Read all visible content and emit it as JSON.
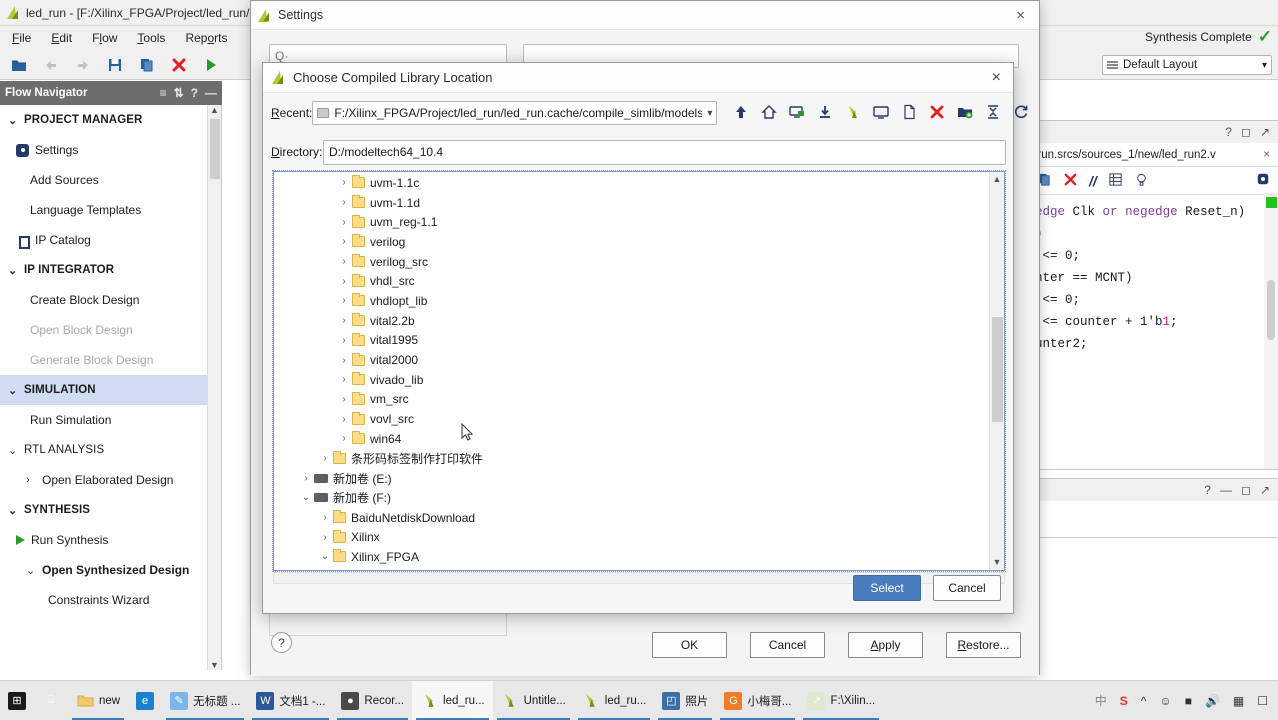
{
  "vivado": {
    "title": "led_run - [F:/Xilinx_FPGA/Project/led_run/le",
    "menus": [
      "File",
      "Edit",
      "Flow",
      "Tools",
      "Reports"
    ],
    "status_label": "Synthesis Complete",
    "layout_value": "Default Layout",
    "flow_navigator": {
      "title": "Flow Navigator",
      "items": [
        {
          "label": "PROJECT MANAGER",
          "type": "section",
          "chevron": "⌄",
          "highlight": false
        },
        {
          "label": "Settings",
          "type": "item-icon",
          "icon": "gear-icon"
        },
        {
          "label": "Add Sources",
          "type": "item"
        },
        {
          "label": "Language Templates",
          "type": "item"
        },
        {
          "label": "IP Catalog",
          "type": "item-icon",
          "icon": "ip-catalog-icon"
        },
        {
          "label": "IP INTEGRATOR",
          "type": "section",
          "chevron": "⌄",
          "highlight": false
        },
        {
          "label": "Create Block Design",
          "type": "item"
        },
        {
          "label": "Open Block Design",
          "type": "item-dim"
        },
        {
          "label": "Generate Block Design",
          "type": "item-dim"
        },
        {
          "label": "SIMULATION",
          "type": "section",
          "chevron": "⌄",
          "highlight": true
        },
        {
          "label": "Run Simulation",
          "type": "item"
        },
        {
          "label": "RTL ANALYSIS",
          "type": "section-light",
          "chevron": "⌄"
        },
        {
          "label": "Open Elaborated Design",
          "type": "sub-collapsed",
          "chevron": "›"
        },
        {
          "label": "SYNTHESIS",
          "type": "section",
          "chevron": "⌄",
          "highlight": false
        },
        {
          "label": "Run Synthesis",
          "type": "item-play"
        },
        {
          "label": "Open Synthesized Design",
          "type": "sub-expanded",
          "chevron": "⌄"
        },
        {
          "label": "Constraints Wizard",
          "type": "item-deep"
        }
      ]
    },
    "code_panel": {
      "tab_label": "_run.srcs/sources_1/new/led_run2.v",
      "lines": [
        "edge Clk or negedge Reset_n)",
        ")",
        " <= 0;",
        "nter == MCNT)",
        " <= 0;",
        "",
        " <= counter + 1'b1;",
        "",
        "unter2;"
      ]
    }
  },
  "settings_dialog": {
    "title": "Settings",
    "search_placeholder": "Q·",
    "buttons": [
      {
        "label": "OK",
        "accel": ""
      },
      {
        "label": "Cancel",
        "accel": ""
      },
      {
        "label": "Apply",
        "accel": "A"
      },
      {
        "label": "Restore...",
        "accel": "R"
      }
    ],
    "help_label": "?"
  },
  "chooser_dialog": {
    "title": "Choose Compiled Library Location",
    "recent_label": "Recent:",
    "recent_value": "F:/Xilinx_FPGA/Project/led_run/led_run.cache/compile_simlib/modelsim",
    "directory_label": "Directory:",
    "directory_value": "D:/modeltech64_10.4",
    "toolbar_icons": [
      "parent-directory-icon",
      "home-icon",
      "new-folder-monitor-icon",
      "download-icon",
      "vivado-icon",
      "monitor-icon",
      "new-file-icon",
      "delete-icon",
      "add-folder-icon",
      "collapse-all-icon",
      "refresh-icon"
    ],
    "tree_items": [
      {
        "label": "uvm-1.1c",
        "indent": 3,
        "icon": "folder",
        "arrow": "›"
      },
      {
        "label": "uvm-1.1d",
        "indent": 3,
        "icon": "folder",
        "arrow": "›"
      },
      {
        "label": "uvm_reg-1.1",
        "indent": 3,
        "icon": "folder",
        "arrow": "›"
      },
      {
        "label": "verilog",
        "indent": 3,
        "icon": "folder",
        "arrow": "›"
      },
      {
        "label": "verilog_src",
        "indent": 3,
        "icon": "folder",
        "arrow": "›"
      },
      {
        "label": "vhdl_src",
        "indent": 3,
        "icon": "folder",
        "arrow": "›"
      },
      {
        "label": "vhdlopt_lib",
        "indent": 3,
        "icon": "folder",
        "arrow": "›"
      },
      {
        "label": "vital2.2b",
        "indent": 3,
        "icon": "folder",
        "arrow": "›"
      },
      {
        "label": "vital1995",
        "indent": 3,
        "icon": "folder",
        "arrow": "›"
      },
      {
        "label": "vital2000",
        "indent": 3,
        "icon": "folder",
        "arrow": "›"
      },
      {
        "label": "vivado_lib",
        "indent": 3,
        "icon": "folder",
        "arrow": "›"
      },
      {
        "label": "vm_src",
        "indent": 3,
        "icon": "folder",
        "arrow": "›"
      },
      {
        "label": "vovl_src",
        "indent": 3,
        "icon": "folder",
        "arrow": "›"
      },
      {
        "label": "win64",
        "indent": 3,
        "icon": "folder",
        "arrow": "›"
      },
      {
        "label": "条形码标签制作打印软件",
        "indent": 2,
        "icon": "folder",
        "arrow": "›"
      },
      {
        "label": "新加卷 (E:)",
        "indent": 1,
        "icon": "drive",
        "arrow": "›"
      },
      {
        "label": "新加卷 (F:)",
        "indent": 1,
        "icon": "drive",
        "arrow": "⌄"
      },
      {
        "label": "BaiduNetdiskDownload",
        "indent": 2,
        "icon": "folder",
        "arrow": "›"
      },
      {
        "label": "Xilinx",
        "indent": 2,
        "icon": "folder",
        "arrow": "›"
      },
      {
        "label": "Xilinx_FPGA",
        "indent": 2,
        "icon": "folder",
        "arrow": "⌄"
      }
    ],
    "select_label": "Select",
    "cancel_label": "Cancel"
  },
  "taskbar": {
    "items": [
      {
        "label": "",
        "icon": "windows-start-icon",
        "color": "#1a1a1a",
        "glyph": "⊞",
        "state": "none"
      },
      {
        "label": "",
        "icon": "task-view-icon",
        "color": "transparent",
        "glyph": "⌸",
        "state": "none"
      },
      {
        "label": "new",
        "icon": "folder-icon",
        "color": "#f5c76a",
        "glyph": "",
        "state": "run"
      },
      {
        "label": "",
        "icon": "edge-browser-icon",
        "color": "#1b80d0",
        "glyph": "e",
        "state": "none"
      },
      {
        "label": "无标题 ...",
        "icon": "paint-icon",
        "color": "#7db5e8",
        "glyph": "✎",
        "state": "run"
      },
      {
        "label": "文档1 -...",
        "icon": "word-icon",
        "color": "#2b579a",
        "glyph": "W",
        "state": "run"
      },
      {
        "label": "Recor...",
        "icon": "recorder-icon",
        "color": "#4a4a4a",
        "glyph": "●",
        "state": "run"
      },
      {
        "label": "led_ru...",
        "icon": "vivado-icon",
        "color": "#b5c92e",
        "glyph": "",
        "state": "active"
      },
      {
        "label": "Untitle...",
        "icon": "vivado-icon",
        "color": "#b5c92e",
        "glyph": "",
        "state": "run"
      },
      {
        "label": "led_ru...",
        "icon": "vivado-icon",
        "color": "#b5c92e",
        "glyph": "",
        "state": "run"
      },
      {
        "label": "照片",
        "icon": "photos-icon",
        "color": "#3a6ea5",
        "glyph": "◰",
        "state": "run"
      },
      {
        "label": "小梅哥...",
        "icon": "app-icon",
        "color": "#f07c2a",
        "glyph": "G",
        "state": "run"
      },
      {
        "label": "F:\\Xilin...",
        "icon": "modelsim-icon",
        "color": "#dfe8d0",
        "glyph": "↗",
        "state": "run"
      }
    ],
    "tray": [
      "∧",
      "☻",
      "⚡",
      "ᵕ)",
      "▨",
      "▢"
    ],
    "ime_label": "中",
    "sogou_label": "S"
  }
}
